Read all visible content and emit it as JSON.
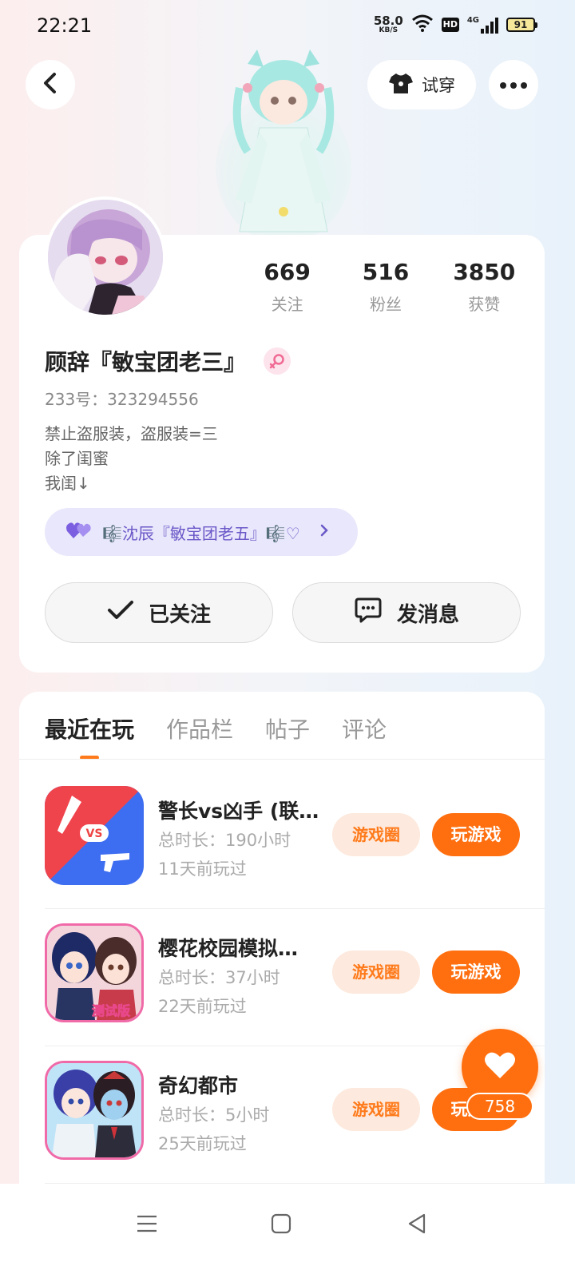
{
  "status_bar": {
    "time": "22:21",
    "net_speed": "58.0",
    "net_unit": "KB/S",
    "hd": "HD",
    "network": "4G",
    "battery": "91"
  },
  "header": {
    "try_on_label": "试穿"
  },
  "profile": {
    "stats": [
      {
        "value": "669",
        "label": "关注"
      },
      {
        "value": "516",
        "label": "粉丝"
      },
      {
        "value": "3850",
        "label": "获赞"
      }
    ],
    "username": "顾辞『敏宝团老三』",
    "user_id": "233号：323294556",
    "bio": "禁止盗服装，盗服装=三\n除了闺蜜\n我闺↓",
    "relation_tag": "🎼沈辰『敏宝团老五』🎼♡",
    "followed_label": "已关注",
    "message_label": "发消息"
  },
  "tabs": [
    "最近在玩",
    "作品栏",
    "帖子",
    "评论"
  ],
  "games": [
    {
      "name": "警长vs凶手 (联…",
      "time": "总时长：190小时",
      "last": "11天前玩过",
      "circle": "游戏圈",
      "play": "玩游戏"
    },
    {
      "name": "樱花校园模拟…",
      "time": "总时长：37小时",
      "last": "22天前玩过",
      "circle": "游戏圈",
      "play": "玩游戏"
    },
    {
      "name": "奇幻都市",
      "time": "总时长：5小时",
      "last": "25天前玩过",
      "circle": "游戏圈",
      "play": "玩游戏"
    }
  ],
  "game_icon_texts": {
    "vs": "VS",
    "test": "测试版"
  },
  "like": {
    "count": "758"
  },
  "colors": {
    "accent": "#ff6f0f",
    "tag_bg": "#e9e7fb",
    "tag_text": "#6a58c8"
  }
}
